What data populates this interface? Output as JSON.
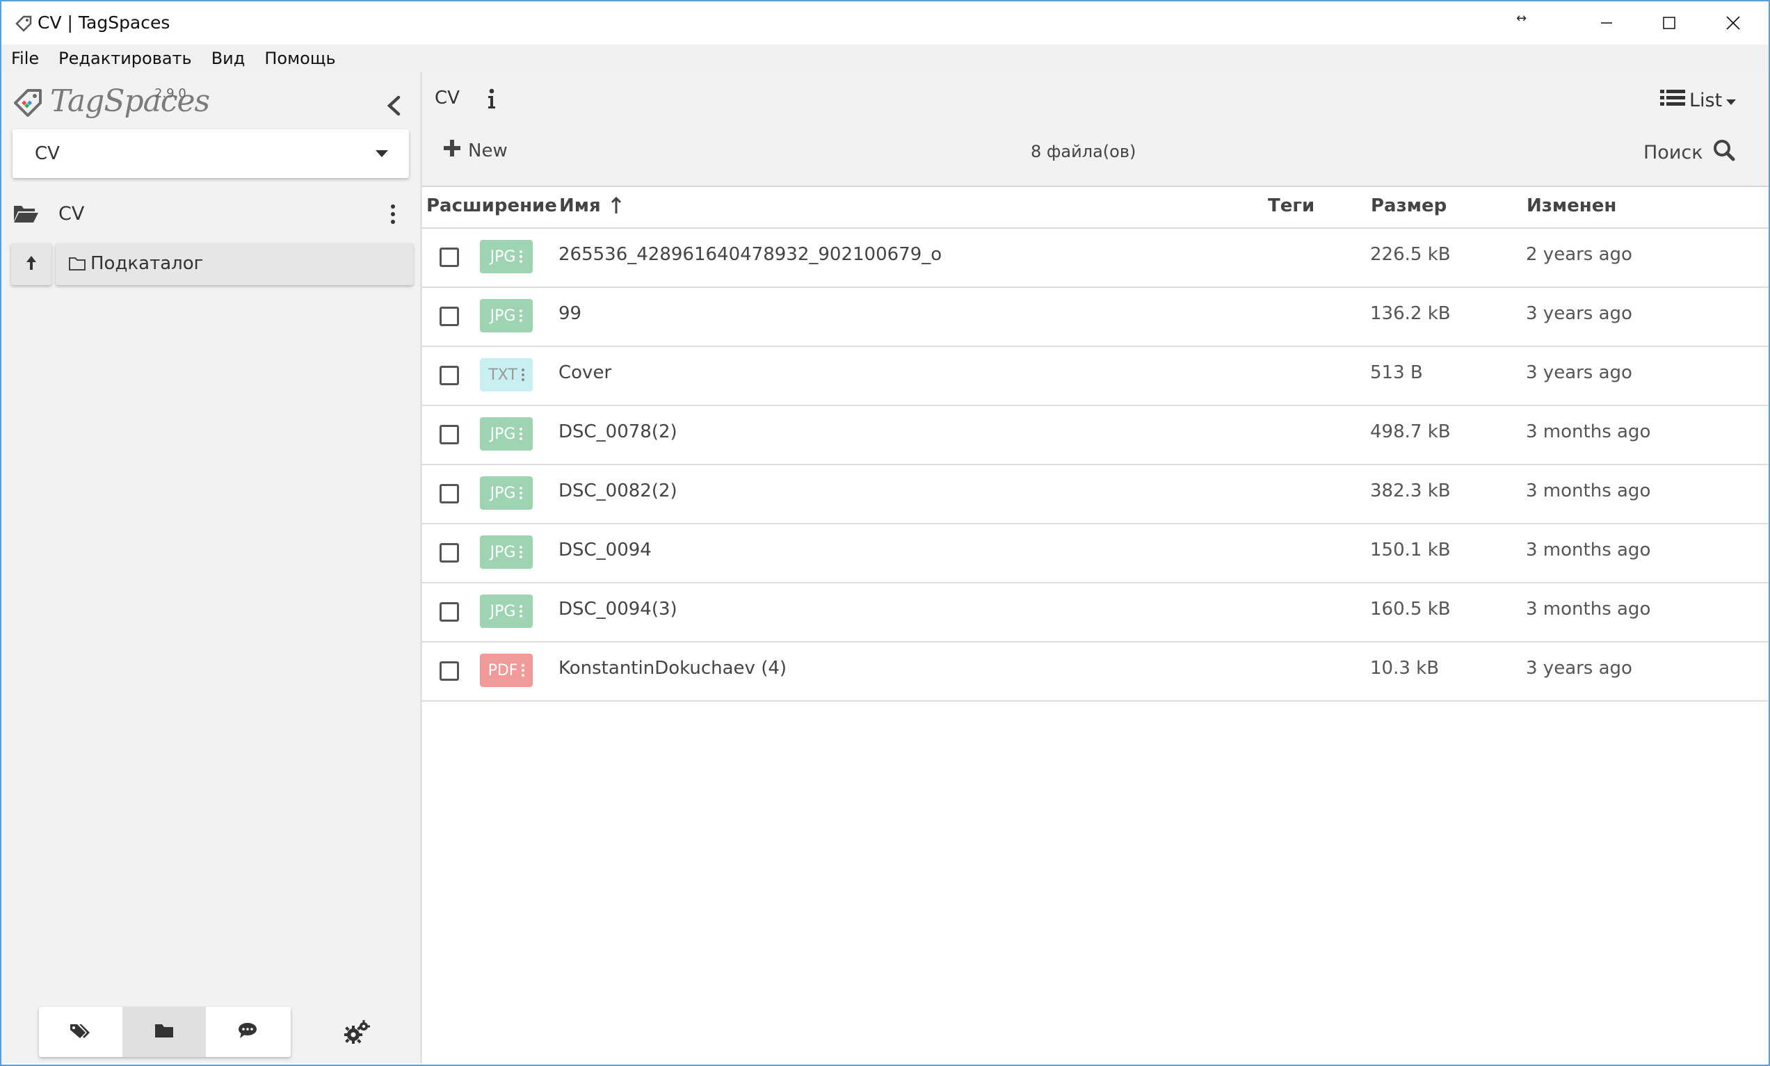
{
  "window": {
    "title": "CV | TagSpaces",
    "grip": "↔"
  },
  "menu": [
    "File",
    "Редактировать",
    "Вид",
    "Помощь"
  ],
  "sidebar": {
    "logo_text": "TagSpaces",
    "version": "2.9.0",
    "location_select": "CV",
    "directory_name": "CV",
    "subdirectory": "Подкаталог"
  },
  "toolbar": {
    "breadcrumb": "CV",
    "view_mode": "List",
    "new_label": "New",
    "file_count": "8 файла(ов)",
    "search_label": "Поиск"
  },
  "table": {
    "headers": {
      "extension": "Расширение",
      "name": "Имя",
      "tags": "Теги",
      "size": "Размер",
      "modified": "Изменен"
    },
    "rows": [
      {
        "ext": "JPG",
        "color": "#9fd4b3",
        "name": "265536_428961640478932_902100679_o",
        "size": "226.5 kB",
        "modified": "2 years ago"
      },
      {
        "ext": "JPG",
        "color": "#9fd4b3",
        "name": "99",
        "size": "136.2 kB",
        "modified": "3 years ago"
      },
      {
        "ext": "TXT",
        "color": "#c8f0f0",
        "name": "Cover",
        "size": "513 B",
        "modified": "3 years ago"
      },
      {
        "ext": "JPG",
        "color": "#9fd4b3",
        "name": "DSC_0078(2)",
        "size": "498.7 kB",
        "modified": "3 months ago"
      },
      {
        "ext": "JPG",
        "color": "#9fd4b3",
        "name": "DSC_0082(2)",
        "size": "382.3 kB",
        "modified": "3 months ago"
      },
      {
        "ext": "JPG",
        "color": "#9fd4b3",
        "name": "DSC_0094",
        "size": "150.1 kB",
        "modified": "3 months ago"
      },
      {
        "ext": "JPG",
        "color": "#9fd4b3",
        "name": "DSC_0094(3)",
        "size": "160.5 kB",
        "modified": "3 months ago"
      },
      {
        "ext": "PDF",
        "color": "#f19a9a",
        "name": "KonstantinDokuchaev (4)",
        "size": "10.3 kB",
        "modified": "3 years ago"
      }
    ]
  },
  "colors": {
    "accent_fab": "#d4e62c",
    "window_border": "#5a9fd8",
    "sidebar_bg": "#f2f2f2"
  },
  "icons": {
    "sidebar_bottom": [
      "tags-icon",
      "folder-icon",
      "chat-icon"
    ],
    "settings": "gears-icon"
  }
}
